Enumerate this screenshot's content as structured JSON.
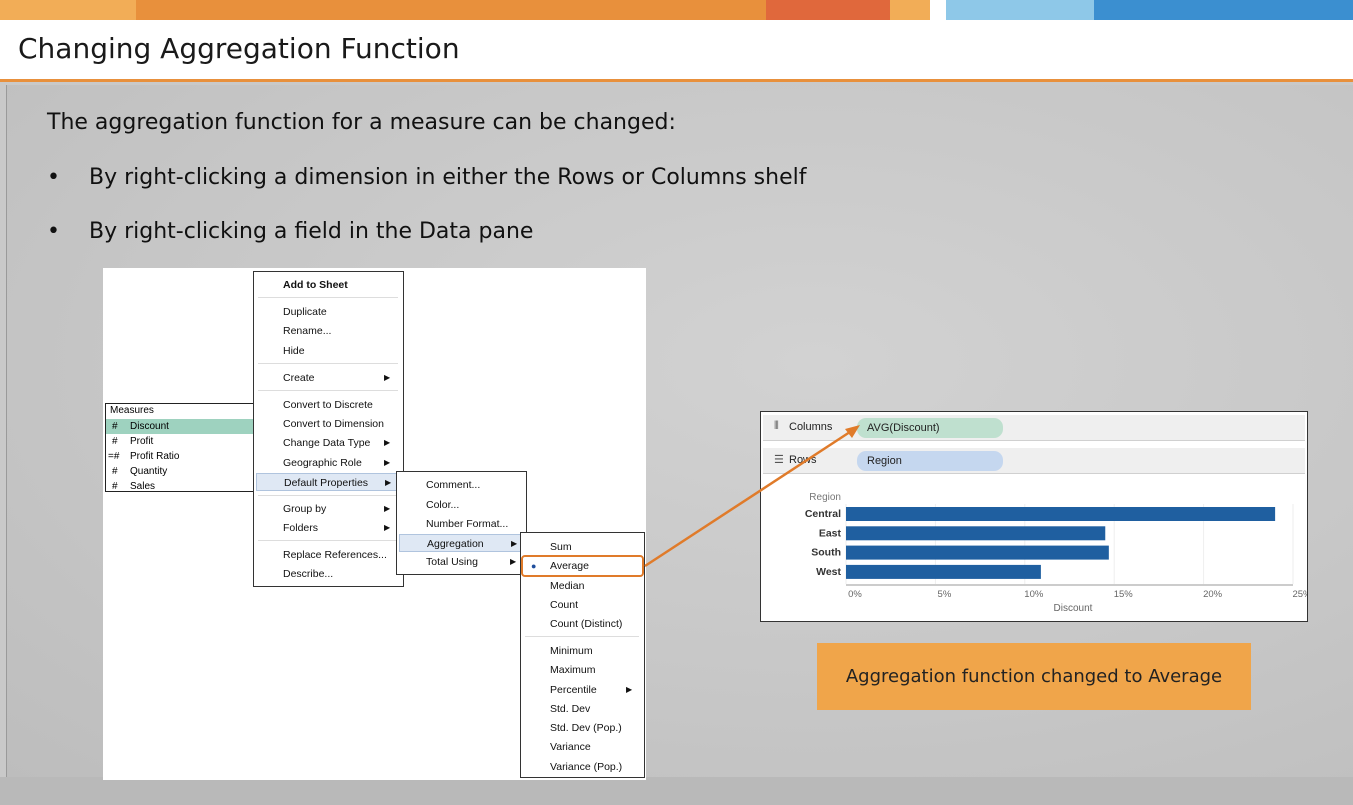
{
  "slide": {
    "title": "Changing Aggregation Function",
    "intro": "The aggregation function for a measure can be changed:",
    "bullets": [
      "By right-clicking a dimension in either the Rows or Columns shelf",
      "By right-clicking a field in the Data pane"
    ],
    "callout": "Aggregation function changed to Average"
  },
  "colors": {
    "accent_orange": "#e8903c",
    "bar_blue": "#1f5fa0",
    "callout_orange": "#f0a54a",
    "columns_pill": "#bfe0cf",
    "rows_pill": "#c5d7ef"
  },
  "measures_pane": {
    "header": "Measures",
    "items": [
      {
        "icon": "#",
        "label": "Discount",
        "selected": true
      },
      {
        "icon": "#",
        "label": "Profit"
      },
      {
        "icon": "=#",
        "label": "Profit Ratio"
      },
      {
        "icon": "#",
        "label": "Quantity"
      },
      {
        "icon": "#",
        "label": "Sales"
      }
    ]
  },
  "context_menu": {
    "items": [
      {
        "label": "Add to Sheet",
        "bold": true
      },
      {
        "label": "Duplicate"
      },
      {
        "label": "Rename..."
      },
      {
        "label": "Hide"
      },
      {
        "label": "Create",
        "submenu": true
      },
      {
        "label": "Convert to Discrete"
      },
      {
        "label": "Convert to Dimension"
      },
      {
        "label": "Change Data Type",
        "submenu": true
      },
      {
        "label": "Geographic Role",
        "submenu": true
      },
      {
        "label": "Default Properties",
        "submenu": true,
        "highlighted": true
      },
      {
        "label": "Group by",
        "submenu": true
      },
      {
        "label": "Folders",
        "submenu": true
      },
      {
        "label": "Replace References..."
      },
      {
        "label": "Describe..."
      }
    ]
  },
  "default_properties_menu": {
    "items": [
      {
        "label": "Comment..."
      },
      {
        "label": "Color..."
      },
      {
        "label": "Number Format..."
      },
      {
        "label": "Aggregation",
        "submenu": true,
        "highlighted": true
      },
      {
        "label": "Total Using",
        "submenu": true
      }
    ]
  },
  "aggregation_menu": {
    "items": [
      {
        "label": "Sum"
      },
      {
        "label": "Average",
        "checked": true
      },
      {
        "label": "Median"
      },
      {
        "label": "Count"
      },
      {
        "label": "Count (Distinct)"
      },
      {
        "label": "Minimum"
      },
      {
        "label": "Maximum"
      },
      {
        "label": "Percentile",
        "submenu": true
      },
      {
        "label": "Std. Dev"
      },
      {
        "label": "Std. Dev (Pop.)"
      },
      {
        "label": "Variance"
      },
      {
        "label": "Variance (Pop.)"
      }
    ]
  },
  "viz": {
    "columns_label": "Columns",
    "rows_label": "Rows",
    "columns_pill": "AVG(Discount)",
    "rows_pill": "Region"
  },
  "chart_data": {
    "type": "bar",
    "orientation": "horizontal",
    "categories": [
      "Central",
      "East",
      "South",
      "West"
    ],
    "values": [
      0.24,
      0.145,
      0.147,
      0.109
    ],
    "xlabel": "Discount",
    "ylabel": "Region",
    "xlim": [
      0,
      0.25
    ],
    "xticks": [
      "0%",
      "5%",
      "10%",
      "15%",
      "20%",
      "25%"
    ]
  }
}
